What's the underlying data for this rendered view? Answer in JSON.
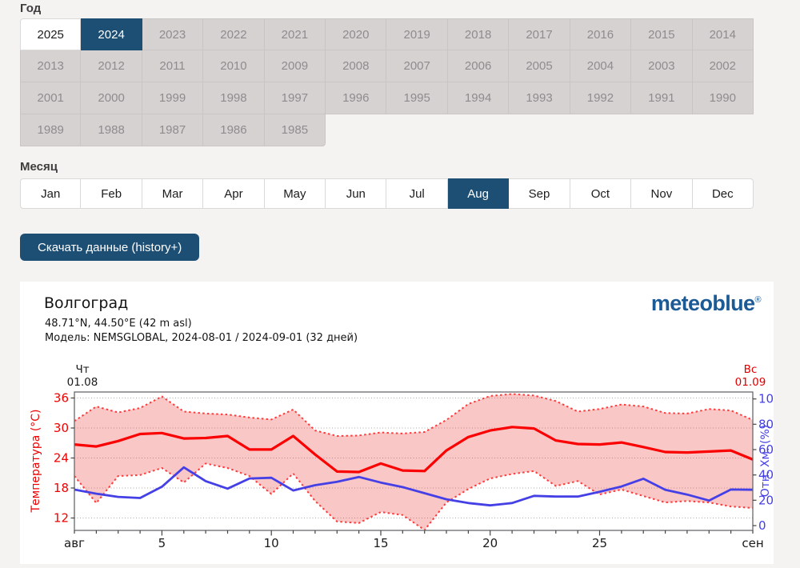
{
  "theme": {
    "accent": "#1d4e74",
    "page_bg": "#f5f3f1",
    "inactive_btn_bg": "#d6d2d2",
    "inactive_btn_text": "#8f8b8e",
    "logo_color": "#1c5a96"
  },
  "year_selector": {
    "label": "Год",
    "selected": "2024",
    "highlighted": "2025",
    "years": [
      "2025",
      "2024",
      "2023",
      "2022",
      "2021",
      "2020",
      "2019",
      "2018",
      "2017",
      "2016",
      "2015",
      "2014",
      "2013",
      "2012",
      "2011",
      "2010",
      "2009",
      "2008",
      "2007",
      "2006",
      "2005",
      "2004",
      "2003",
      "2002",
      "2001",
      "2000",
      "1999",
      "1998",
      "1997",
      "1996",
      "1995",
      "1994",
      "1993",
      "1992",
      "1991",
      "1990",
      "1989",
      "1988",
      "1987",
      "1986",
      "1985"
    ]
  },
  "month_selector": {
    "label": "Месяц",
    "selected": "Aug",
    "months": [
      "Jan",
      "Feb",
      "Mar",
      "Apr",
      "May",
      "Jun",
      "Jul",
      "Aug",
      "Sep",
      "Oct",
      "Nov",
      "Dec"
    ]
  },
  "download_button": {
    "label": "Скачать данные (history+)"
  },
  "chart_card": {
    "title": "Волгоград",
    "coordinates": "48.71°N, 44.50°E (42 m asl)",
    "model_line": "Модель: NEMSGLOBAL, 2024-08-01 / 2024-09-01 (32 дней)",
    "logo_text": "meteoblue",
    "logo_mark": "®"
  },
  "chart_data": {
    "type": "line",
    "title": "Волгоград",
    "days": 32,
    "day_markers": {
      "start": {
        "weekday": "Чт",
        "date": "01.08",
        "color": "#1a1a1a"
      },
      "end": {
        "weekday": "Вс",
        "date": "01.09",
        "color": "#e00000"
      }
    },
    "x_axis": {
      "start_label": "авг",
      "end_label": "сен",
      "ticks": [
        5,
        10,
        15,
        20,
        25
      ],
      "tick_every_day": true
    },
    "y_left": {
      "label": "Температура (°C)",
      "ticks": [
        36,
        30,
        24,
        18,
        12
      ],
      "color": "#f00000",
      "range": [
        9.6,
        37.2
      ]
    },
    "y_right": {
      "label": "Отн. Хм. (%)",
      "ticks": [
        100,
        80,
        60,
        40,
        20,
        0
      ],
      "color": "#4540e6",
      "range": [
        -3,
        104
      ]
    },
    "grid": true,
    "band": {
      "between": [
        "temperature_min",
        "temperature_max"
      ],
      "fill": "rgba(240,70,70,0.30)"
    },
    "series": [
      {
        "name": "temperature_mean",
        "axis": "left",
        "style": "solid",
        "color": "#fa0000",
        "width": 3.2,
        "values": [
          26.7,
          26.3,
          27.4,
          28.8,
          29.0,
          27.9,
          28.0,
          28.4,
          25.7,
          25.7,
          28.4,
          24.7,
          21.3,
          21.2,
          22.9,
          21.5,
          21.4,
          25.5,
          28.2,
          29.5,
          30.2,
          29.9,
          27.5,
          26.8,
          26.7,
          27.1,
          26.2,
          25.2,
          25.1,
          25.3,
          25.5,
          23.7
        ]
      },
      {
        "name": "temperature_max",
        "axis": "left",
        "style": "dotted",
        "color": "#ff3b3b",
        "width": 2,
        "values": [
          31.4,
          34.3,
          33.1,
          34.0,
          36.3,
          33.3,
          32.9,
          32.7,
          32.1,
          31.7,
          33.7,
          29.5,
          28.4,
          28.5,
          29.1,
          28.9,
          29.2,
          31.6,
          34.8,
          36.4,
          36.8,
          36.5,
          35.4,
          33.3,
          33.8,
          34.7,
          34.3,
          33.0,
          32.9,
          33.8,
          33.5,
          31.6
        ]
      },
      {
        "name": "temperature_min",
        "axis": "left",
        "style": "dotted",
        "color": "#ff3b3b",
        "width": 2,
        "values": [
          20.4,
          15.0,
          20.4,
          20.6,
          22.0,
          19.1,
          22.9,
          22.0,
          20.4,
          16.8,
          20.9,
          15.4,
          11.3,
          11.0,
          13.2,
          12.6,
          9.6,
          15.1,
          17.8,
          19.9,
          20.8,
          21.4,
          18.4,
          19.4,
          16.7,
          17.7,
          16.4,
          15.1,
          15.4,
          15.1,
          14.3,
          14.0
        ]
      },
      {
        "name": "relative_humidity",
        "axis": "right",
        "style": "solid",
        "color": "#4540e6",
        "width": 2.8,
        "values": [
          28.4,
          25.2,
          22.7,
          21.8,
          30.7,
          46.0,
          35.1,
          29.2,
          37.2,
          37.8,
          27.7,
          31.9,
          34.6,
          38.4,
          34.0,
          30.4,
          25.6,
          20.8,
          17.8,
          16.0,
          17.8,
          23.5,
          22.9,
          22.9,
          26.7,
          30.9,
          37.0,
          28.3,
          24.5,
          19.8,
          28.5,
          28.3
        ]
      }
    ]
  }
}
